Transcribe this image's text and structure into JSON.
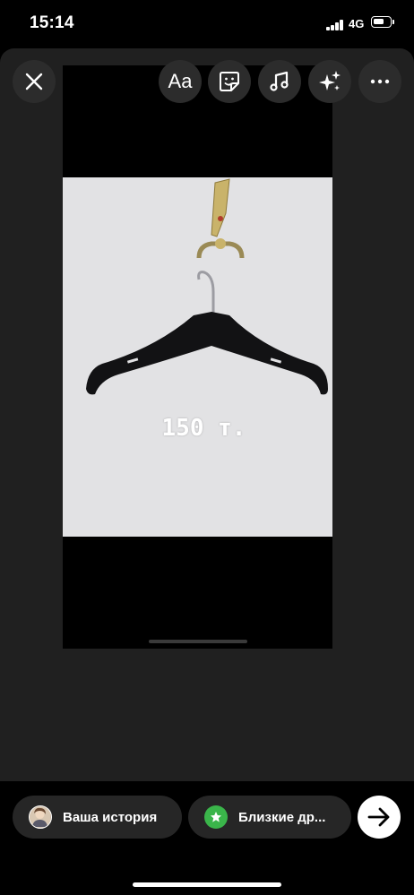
{
  "status_bar": {
    "time": "15:14",
    "network": "4G"
  },
  "toolbar": {
    "close_icon": "close-icon",
    "text_label": "Aa",
    "sticker_icon": "sticker-icon",
    "music_icon": "music-note-icon",
    "effects_icon": "sparkles-icon",
    "more_icon": "more-horizontal-icon"
  },
  "story": {
    "price_text": "150 т."
  },
  "share": {
    "your_story_label": "Ваша история",
    "close_friends_label": "Близкие др...",
    "send_icon": "arrow-right-icon"
  },
  "colors": {
    "panel": "#202020",
    "pill": "#262626",
    "close_friends": "#3ab54a"
  }
}
